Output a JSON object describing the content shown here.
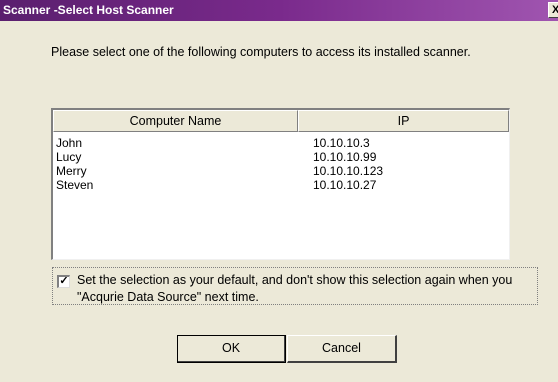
{
  "window": {
    "title": "Scanner -Select Host Scanner",
    "close_label": "X"
  },
  "instruction": "Please select one of the following computers to access its installed scanner.",
  "table": {
    "columns": [
      "Computer Name",
      "IP"
    ],
    "rows": [
      {
        "name": "John",
        "ip": "10.10.10.3"
      },
      {
        "name": "Lucy",
        "ip": "10.10.10.99"
      },
      {
        "name": "Merry",
        "ip": "10.10.10.123"
      },
      {
        "name": "Steven",
        "ip": "10.10.10.27"
      }
    ]
  },
  "default_option": {
    "checked": true,
    "check_mark": "✓",
    "label": "Set the selection as your default, and don't show this selection again when you \"Acqurie Data Source\" next time."
  },
  "buttons": {
    "ok": "OK",
    "cancel": "Cancel"
  },
  "colors": {
    "titlebar": "#7a2a8c",
    "dialog_bg": "#ece9d8"
  }
}
